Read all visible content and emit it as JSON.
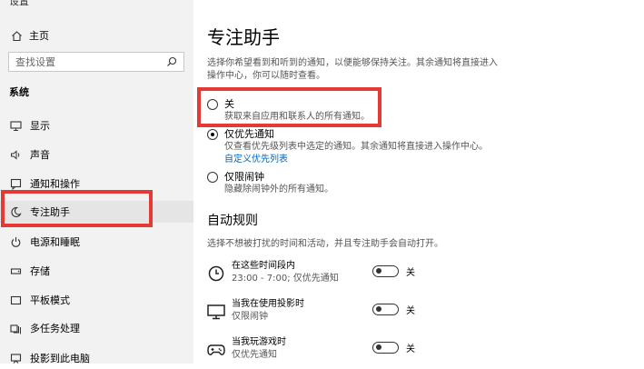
{
  "window_title": "设置",
  "sidebar": {
    "home_label": "主页",
    "search_placeholder": "查找设置",
    "section_label": "系统",
    "items": [
      {
        "label": "显示",
        "icon": "display-icon"
      },
      {
        "label": "声音",
        "icon": "speaker-icon"
      },
      {
        "label": "通知和操作",
        "icon": "notification-icon"
      },
      {
        "label": "专注助手",
        "icon": "moon-icon",
        "selected": true
      },
      {
        "label": "电源和睡眠",
        "icon": "power-icon"
      },
      {
        "label": "存储",
        "icon": "storage-icon"
      },
      {
        "label": "平板模式",
        "icon": "tablet-icon"
      },
      {
        "label": "多任务处理",
        "icon": "multitask-icon"
      },
      {
        "label": "投影到此电脑",
        "icon": "project-icon"
      }
    ]
  },
  "main": {
    "title": "专注助手",
    "description_line1": "选择你希望看到和听到的通知，以便能够保持关注。其余通知将直接进入",
    "description_line2": "操作中心，你可以随时查看。",
    "options": [
      {
        "label": "关",
        "sub": "获取来自应用和联系人的所有通知。",
        "checked": false
      },
      {
        "label": "仅优先通知",
        "sub": "仅查看优先级列表中选定的通知。其余通知将直接进入操作中心。",
        "link": "自定义优先列表",
        "checked": true
      },
      {
        "label": "仅限闹钟",
        "sub": "隐藏除闹钟外的所有通知。",
        "checked": false
      }
    ],
    "auto_rules_title": "自动规则",
    "auto_rules_desc": "选择不想被打扰的时间和活动，并且专注助手会自动打开。",
    "rules": [
      {
        "title": "在这些时间段内",
        "sub": "23:00 - 7:00; 仅优先通知",
        "state": "关",
        "icon": "clock-icon"
      },
      {
        "title": "当我在使用投影时",
        "sub": "仅限闹钟",
        "state": "关",
        "icon": "monitor-icon"
      },
      {
        "title": "当我玩游戏时",
        "sub": "仅优先通知",
        "state": "关",
        "icon": "gamepad-icon"
      }
    ]
  },
  "colors": {
    "highlight": "#e53935",
    "link": "#0067c0",
    "sidebar_bg": "#f2f2f2"
  }
}
